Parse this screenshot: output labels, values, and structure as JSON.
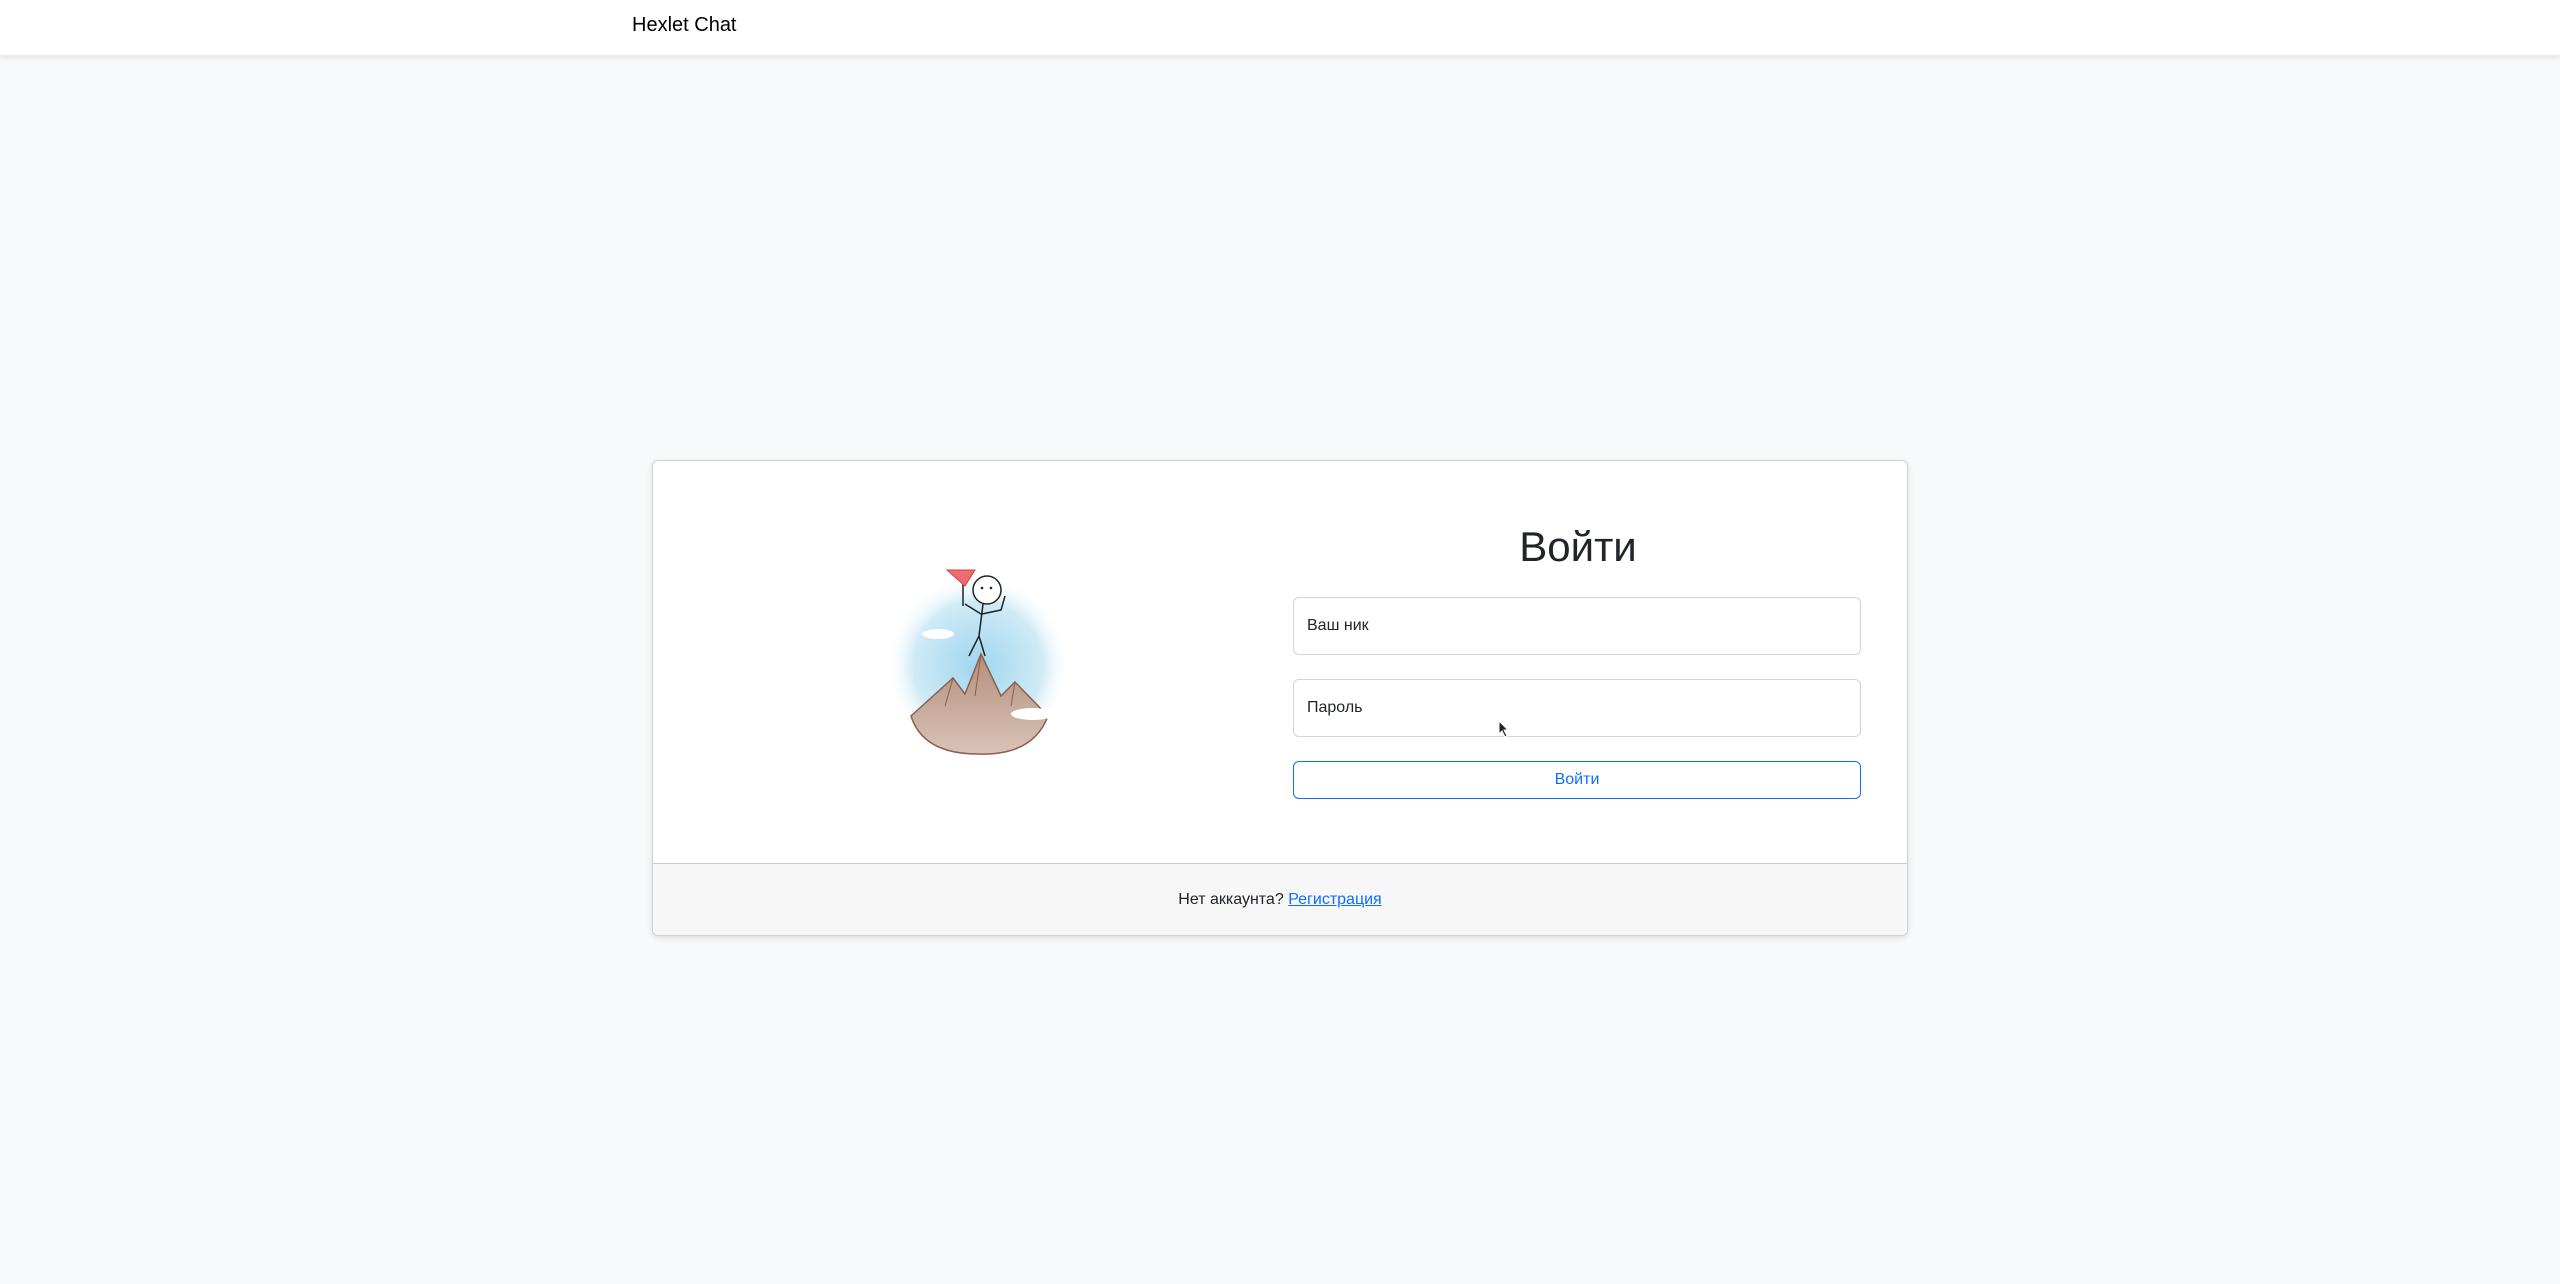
{
  "navbar": {
    "brand": "Hexlet Chat"
  },
  "login": {
    "title": "Войти",
    "username_label": "Ваш ник",
    "password_label": "Пароль",
    "submit_label": "Войти"
  },
  "footer": {
    "prompt": "Нет аккаунта?",
    "signup_link": "Регистрация"
  },
  "colors": {
    "accent": "#0d6efd",
    "background": "#f8f9fa",
    "card_footer": "#f7f7f7"
  },
  "icons": {
    "illustration": "climber-on-mountain-illustration",
    "cursor": "mouse-pointer-icon"
  }
}
